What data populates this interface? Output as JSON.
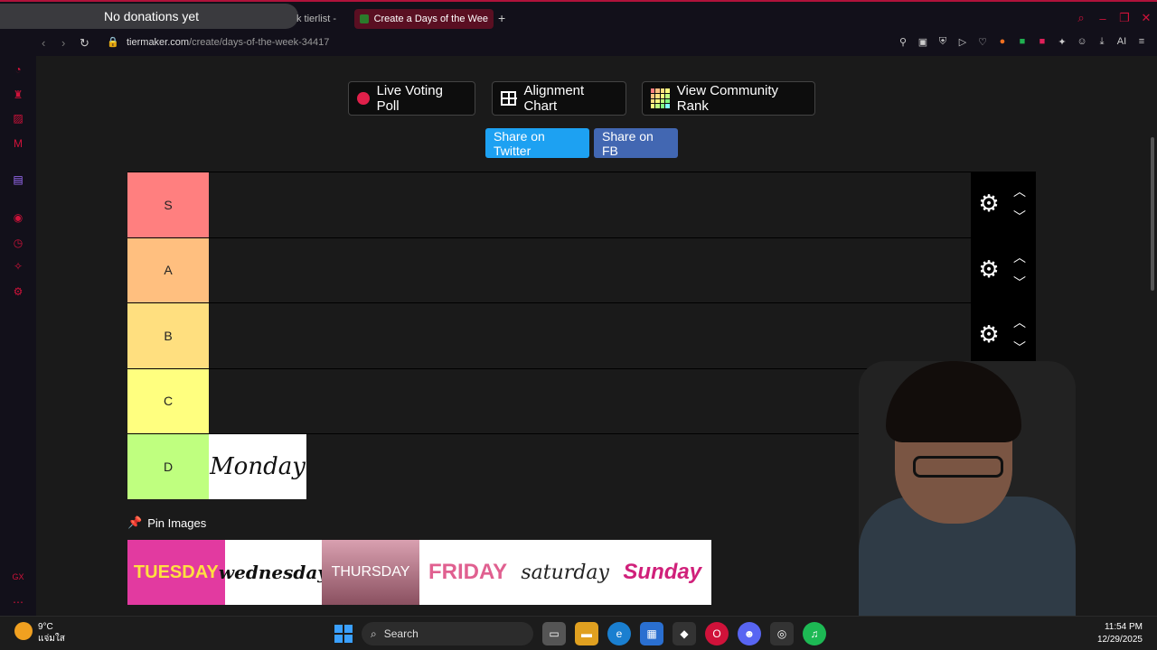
{
  "browser": {
    "donation_text": "No donations yet",
    "tabs": [
      {
        "label": "k tierlist -"
      },
      {
        "label": "Create a Days of the Week"
      }
    ],
    "url_host": "tiermaker.com",
    "url_path": "/create/days-of-the-week-34417",
    "tools_ai": "AI"
  },
  "buttons": {
    "live_voting": "Live Voting Poll",
    "alignment_chart": "Alignment Chart",
    "community_rank": "View Community Rank",
    "share_twitter": "Share on Twitter",
    "share_fb": "Share on FB"
  },
  "tiers": [
    {
      "label": "S",
      "color": "#ff7f7f"
    },
    {
      "label": "A",
      "color": "#ffbf7f"
    },
    {
      "label": "B",
      "color": "#ffdf7f"
    },
    {
      "label": "C",
      "color": "#ffff7f"
    },
    {
      "label": "D",
      "color": "#bfff7f"
    }
  ],
  "tier_items": {
    "d": [
      "Monday"
    ]
  },
  "pin_images_label": "Pin Images",
  "pool": [
    {
      "label": "TUESDAY",
      "bg": "#e23aa0",
      "fg": "#ffe040"
    },
    {
      "label": "wednesday",
      "bg": "#ffffff",
      "fg": "#111111"
    },
    {
      "label": "THURSDAY",
      "bg": "#b06880",
      "fg": "#ffffff"
    },
    {
      "label": "FRIDAY",
      "bg": "#ffffff",
      "fg": "#e06090"
    },
    {
      "label": "saturday",
      "bg": "#ffffff",
      "fg": "#222222"
    },
    {
      "label": "Sunday",
      "bg": "#ffffff",
      "fg": "#d0207a"
    }
  ],
  "taskbar": {
    "temp": "9°C",
    "weather_desc": "แจ่มใส",
    "weather_badge": "2",
    "search": "Search",
    "time": "11:54 PM",
    "date": "12/29/2025"
  }
}
